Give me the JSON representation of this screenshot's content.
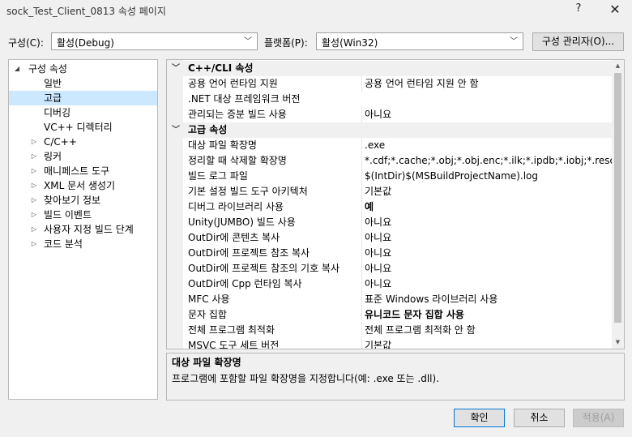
{
  "window": {
    "title": "sock_Test_Client_0813 속성 페이지",
    "help": "?",
    "close": "✕"
  },
  "toolbar": {
    "config_label": "구성(C):",
    "config_value": "활성(Debug)",
    "platform_label": "플랫폼(P):",
    "platform_value": "활성(Win32)",
    "manager_button": "구성 관리자(O)..."
  },
  "tree": {
    "root": "구성 속성",
    "items": [
      {
        "label": "일반",
        "expandable": false,
        "selected": false
      },
      {
        "label": "고급",
        "expandable": false,
        "selected": true
      },
      {
        "label": "디버깅",
        "expandable": false,
        "selected": false
      },
      {
        "label": "VC++ 디렉터리",
        "expandable": false,
        "selected": false
      },
      {
        "label": "C/C++",
        "expandable": true,
        "selected": false
      },
      {
        "label": "링커",
        "expandable": true,
        "selected": false
      },
      {
        "label": "매니페스트 도구",
        "expandable": true,
        "selected": false
      },
      {
        "label": "XML 문서 생성기",
        "expandable": true,
        "selected": false
      },
      {
        "label": "찾아보기 정보",
        "expandable": true,
        "selected": false
      },
      {
        "label": "빌드 이벤트",
        "expandable": true,
        "selected": false
      },
      {
        "label": "사용자 지정 빌드 단계",
        "expandable": true,
        "selected": false
      },
      {
        "label": "코드 분석",
        "expandable": true,
        "selected": false
      }
    ]
  },
  "grid": {
    "rows": [
      {
        "type": "category",
        "label": "C++/CLI 속성"
      },
      {
        "type": "prop",
        "name": "공용 언어 런타임 지원",
        "value": "공용 언어 런타임 지원 안 함",
        "bold": false
      },
      {
        "type": "prop",
        "name": ".NET 대상 프레임워크 버전",
        "value": "",
        "bold": false
      },
      {
        "type": "prop",
        "name": "관리되는 증분 빌드 사용",
        "value": "아니요",
        "bold": false
      },
      {
        "type": "category",
        "label": "고급 속성"
      },
      {
        "type": "prop",
        "name": "대상 파일 확장명",
        "value": ".exe",
        "bold": false
      },
      {
        "type": "prop",
        "name": "정리할 때 삭제할 확장명",
        "value": "*.cdf;*.cache;*.obj;*.obj.enc;*.ilk;*.ipdb;*.iobj;*.resources;*.tlb",
        "bold": false
      },
      {
        "type": "prop",
        "name": "빌드 로그 파일",
        "value": "$(IntDir)$(MSBuildProjectName).log",
        "bold": false
      },
      {
        "type": "prop",
        "name": "기본 설정 빌드 도구 아키텍처",
        "value": "기본값",
        "bold": false
      },
      {
        "type": "prop",
        "name": "디버그 라이브러리 사용",
        "value": "예",
        "bold": true
      },
      {
        "type": "prop",
        "name": "Unity(JUMBO) 빌드 사용",
        "value": "아니요",
        "bold": false
      },
      {
        "type": "prop",
        "name": "OutDir에 콘텐츠 복사",
        "value": "아니요",
        "bold": false
      },
      {
        "type": "prop",
        "name": "OutDir에 프로젝트 참조 복사",
        "value": "아니요",
        "bold": false
      },
      {
        "type": "prop",
        "name": "OutDir에 프로젝트 참조의 기호 복사",
        "value": "아니요",
        "bold": false
      },
      {
        "type": "prop",
        "name": "OutDir에 Cpp 런타임 복사",
        "value": "아니요",
        "bold": false
      },
      {
        "type": "prop",
        "name": "MFC 사용",
        "value": "표준 Windows 라이브러리 사용",
        "bold": false
      },
      {
        "type": "prop",
        "name": "문자 집합",
        "value": "유니코드 문자 집합 사용",
        "bold": true
      },
      {
        "type": "prop",
        "name": "전체 프로그램 최적화",
        "value": "전체 프로그램 최적화 안 함",
        "bold": false
      },
      {
        "type": "prop",
        "name": "MSVC 도구 세트 버전",
        "value": "기본값",
        "bold": false
      }
    ]
  },
  "description": {
    "title": "대상 파일 확장명",
    "text": "프로그램에 포함할 파일 확장명을 지정합니다(예: .exe 또는 .dll)."
  },
  "buttons": {
    "ok": "확인",
    "cancel": "취소",
    "apply": "적용(A)"
  },
  "icons": {
    "expand": "triangle-right-icon",
    "collapse": "chevron-down-icon"
  },
  "colors": {
    "selection": "#cce8ff",
    "accent": "#0078d7"
  }
}
